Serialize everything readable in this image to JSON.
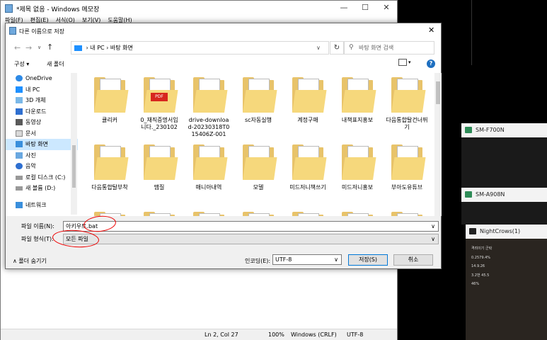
{
  "notepad": {
    "title": "*제목 없음 - Windows 메모장",
    "menu": [
      "파일(F)",
      "편집(E)",
      "서식(O)",
      "보기(V)",
      "도움말(H)"
    ],
    "status": {
      "position": "Ln 2, Col 27",
      "zoom": "100%",
      "eol": "Windows (CRLF)",
      "encoding": "UTF-8"
    },
    "controls": {
      "minimize": "—",
      "maximize": "☐",
      "close": "✕"
    }
  },
  "dialog": {
    "title": "다른 이름으로 저장",
    "close": "✕",
    "path": [
      "내 PC",
      "바탕 화면"
    ],
    "search_placeholder": "바탕 화면 검색",
    "toolbar": {
      "organize": "구성 ▾",
      "new_folder": "새 폴더"
    },
    "tree": [
      "OneDrive",
      "내 PC",
      "3D 개체",
      "다운로드",
      "동영상",
      "문서",
      "바탕 화면",
      "사진",
      "음악",
      "로컬 디스크 (C:)",
      "새 볼륨 (D:)",
      "네트워크"
    ],
    "files": [
      "큘리커",
      "0_재직증명서입니다._230102",
      "drive-download-20230318T015406Z-001",
      "sc자동실행",
      "계정구매",
      "내책표지홍보",
      "다음통합탈건너뛰기",
      "다음통합탈부착",
      "맴질",
      "매니아내역",
      "모델",
      "미드저니책쓰기",
      "미드저니홍보",
      "부아도유튜브",
      "",
      "",
      "",
      "",
      "",
      "",
      ""
    ],
    "pdf_badge": "PDF",
    "filename_label": "파일 이름(N):",
    "filename_value": "아키우트.bat",
    "filetype_label": "파일 형식(T):",
    "filetype_value": "모든 파일",
    "encoding_label": "인코딩(E):",
    "encoding_value": "UTF-8",
    "save": "저장(S)",
    "cancel": "취소",
    "hide_folders": "폴더 숨기기"
  },
  "phones": [
    {
      "title": "SM-F700N"
    },
    {
      "title": "SM-A908N"
    },
    {
      "title": "NightCrows(1)"
    }
  ],
  "game_stats": [
    "격려이기 군락",
    "0.2579.4%",
    "14.9.26",
    "3.2번 45.5",
    "46%"
  ]
}
